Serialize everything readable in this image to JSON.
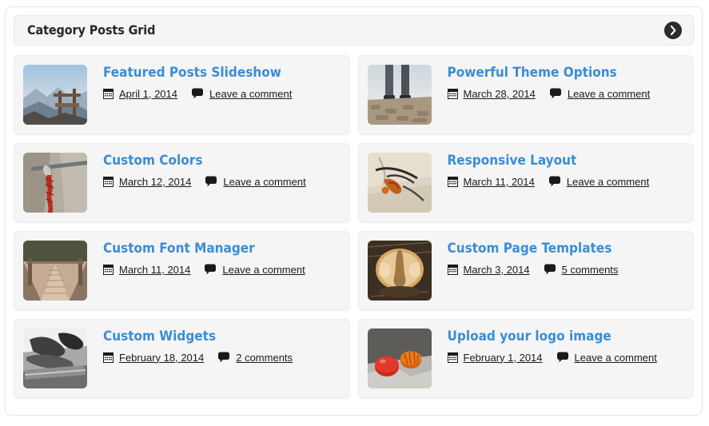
{
  "widget": {
    "title": "Category Posts Grid",
    "toggle_icon": "chevron-right-circle-icon"
  },
  "icons": {
    "calendar": "calendar-icon",
    "comment": "comment-bubble-icon"
  },
  "colors": {
    "title_link": "#3b8dd4",
    "card_background": "#f5f5f5",
    "header_background": "#f5f5f5",
    "toggle_background": "#2b2b2b",
    "text": "#1a1a1a"
  },
  "posts": [
    {
      "title": "Featured Posts Slideshow",
      "date": "April 1, 2014",
      "comments": "Leave a comment",
      "thumb": "mountain-bench-sunrise"
    },
    {
      "title": "Powerful Theme Options",
      "date": "March 28, 2014",
      "comments": "Leave a comment",
      "thumb": "legs-standing-on-rocks"
    },
    {
      "title": "Custom Colors",
      "date": "March 12, 2014",
      "comments": "Leave a comment",
      "thumb": "red-rope-knot-on-rock"
    },
    {
      "title": "Responsive Layout",
      "date": "March 11, 2014",
      "comments": "Leave a comment",
      "thumb": "climbing-gear-on-sand"
    },
    {
      "title": "Custom Font Manager",
      "date": "March 11, 2014",
      "comments": "Leave a comment",
      "thumb": "wooden-bridge-walkway"
    },
    {
      "title": "Custom Page Templates",
      "date": "March 3, 2014",
      "comments": "5 comments",
      "thumb": "cut-tree-stump"
    },
    {
      "title": "Custom Widgets",
      "date": "February 18, 2014",
      "comments": "2 comments",
      "thumb": "grayscale-climbing-boots"
    },
    {
      "title": "Upload your logo image",
      "date": "February 1, 2014",
      "comments": "Leave a comment",
      "thumb": "climbing-helmets-on-rock"
    }
  ]
}
